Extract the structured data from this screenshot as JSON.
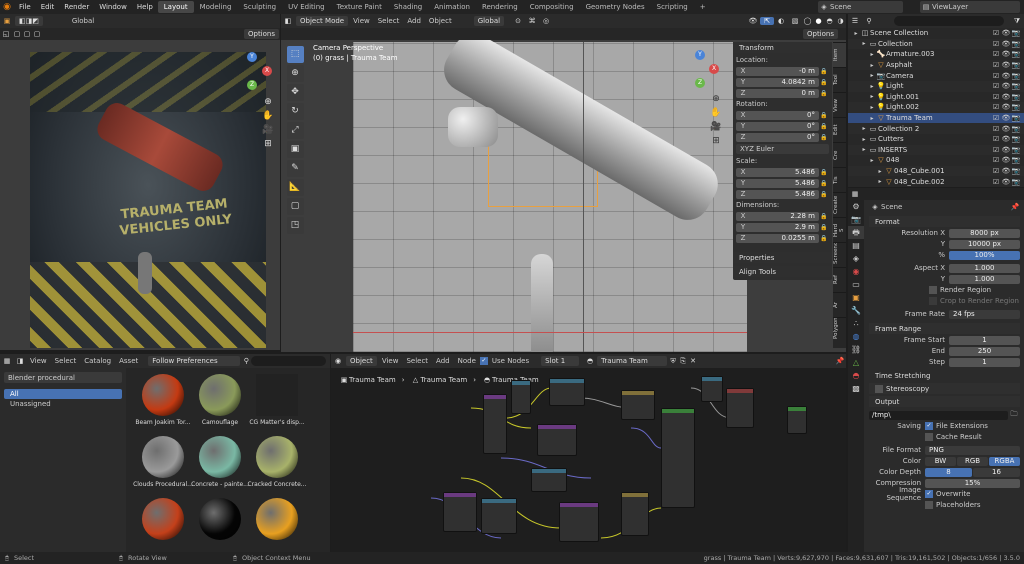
{
  "menu": {
    "items": [
      "File",
      "Edit",
      "Render",
      "Window",
      "Help"
    ]
  },
  "workspaces": {
    "items": [
      "Layout",
      "Modeling",
      "Sculpting",
      "UV Editing",
      "Texture Paint",
      "Shading",
      "Animation",
      "Rendering",
      "Compositing",
      "Geometry Nodes",
      "Scripting"
    ],
    "active": "Layout",
    "add": "+"
  },
  "scene": {
    "name": "Scene",
    "view_layer": "ViewLayer"
  },
  "left_viewport": {
    "orientation": "Global",
    "options": "Options",
    "title_lines": [
      "TRAUMA TEAM",
      "VEHICLES ONLY"
    ]
  },
  "viewport": {
    "mode": "Object Mode",
    "menus": [
      "View",
      "Select",
      "Add",
      "Object"
    ],
    "orientation": "Global",
    "options": "Options",
    "camera_label": "Camera Perspective",
    "object_label": "(0) grass | Trauma Team"
  },
  "transform": {
    "title": "Transform",
    "location_label": "Location:",
    "location": [
      {
        "k": "X",
        "v": "-0 m"
      },
      {
        "k": "Y",
        "v": "4.0842 m"
      },
      {
        "k": "Z",
        "v": "0 m"
      }
    ],
    "rotation_label": "Rotation:",
    "rotation": [
      {
        "k": "X",
        "v": "0°"
      },
      {
        "k": "Y",
        "v": "0°"
      },
      {
        "k": "Z",
        "v": "0°"
      }
    ],
    "euler": "XYZ Euler",
    "scale_label": "Scale:",
    "scale": [
      {
        "k": "X",
        "v": "5.486"
      },
      {
        "k": "Y",
        "v": "5.486"
      },
      {
        "k": "Z",
        "v": "5.486"
      }
    ],
    "dimensions_label": "Dimensions:",
    "dimensions": [
      {
        "k": "X",
        "v": "2.28 m"
      },
      {
        "k": "Y",
        "v": "2.9 m"
      },
      {
        "k": "Z",
        "v": "0.0255 m"
      }
    ],
    "properties": "Properties",
    "align_tools": "Align Tools"
  },
  "sidebar_tabs": [
    "Item",
    "Tool",
    "View",
    "Edit",
    "Cre",
    "Tis",
    "Create",
    "Hard S",
    "Screencast",
    "Ref",
    "Ar",
    "Polygon"
  ],
  "outliner": {
    "items": [
      {
        "name": "Scene Collection",
        "indent": 0
      },
      {
        "name": "Collection",
        "indent": 1
      },
      {
        "name": "Armature.003",
        "indent": 2
      },
      {
        "name": "Asphalt",
        "indent": 2
      },
      {
        "name": "Camera",
        "indent": 2
      },
      {
        "name": "Light",
        "indent": 2
      },
      {
        "name": "Light.001",
        "indent": 2
      },
      {
        "name": "Light.002",
        "indent": 2
      },
      {
        "name": "Trauma Team",
        "indent": 2
      },
      {
        "name": "Collection 2",
        "indent": 1
      },
      {
        "name": "Cutters",
        "indent": 1
      },
      {
        "name": "INSERTS",
        "indent": 1
      },
      {
        "name": "048",
        "indent": 2
      },
      {
        "name": "048_Cube.001",
        "indent": 3
      },
      {
        "name": "048_Cube.002",
        "indent": 3
      }
    ],
    "selected": "Trauma Team"
  },
  "properties": {
    "scene": "Scene",
    "format": "Format",
    "resolution_x_label": "Resolution X",
    "resolution_x": "8000 px",
    "resolution_y_label": "Y",
    "resolution_y": "10000 px",
    "percent_label": "%",
    "percent": "100%",
    "aspect_x_label": "Aspect X",
    "aspect_x": "1.000",
    "aspect_y_label": "Y",
    "aspect_y": "1.000",
    "render_region": "Render Region",
    "crop_region": "Crop to Render Region",
    "frame_rate_label": "Frame Rate",
    "frame_rate": "24 fps",
    "frame_range": "Frame Range",
    "frame_start_label": "Frame Start",
    "frame_start": "1",
    "end_label": "End",
    "end": "250",
    "step_label": "Step",
    "step": "1",
    "time_stretching": "Time Stretching",
    "stereoscopy": "Stereoscopy",
    "output": "Output",
    "path": "/tmp\\",
    "saving_label": "Saving",
    "file_extensions": "File Extensions",
    "cache_result": "Cache Result",
    "file_format_label": "File Format",
    "file_format": "PNG",
    "color_label": "Color",
    "color_opts": [
      "BW",
      "RGB",
      "RGBA"
    ],
    "color_active": "RGBA",
    "color_depth_label": "Color Depth",
    "depth_opts": [
      "8",
      "16"
    ],
    "compression_label": "Compression",
    "compression": "15%",
    "image_sequence_label": "Image Sequence",
    "overwrite": "Overwrite",
    "placeholders": "Placeholders"
  },
  "asset_browser": {
    "menus": [
      "View",
      "Select",
      "Catalog",
      "Asset"
    ],
    "prefs": "Follow Preferences",
    "library": "Blender procedural",
    "catalogs": [
      "All",
      "Unassigned"
    ],
    "assets": [
      {
        "name": "Beam Joakim Tor...",
        "color": "#c43a12"
      },
      {
        "name": "Camouflage",
        "color": "#8a9a5a"
      },
      {
        "name": "CG Matter's disp...",
        "color": "#222222"
      },
      {
        "name": "Clouds Procedural...",
        "color": "#9a9a9a"
      },
      {
        "name": "Concrete - painte...",
        "color": "#7ab8a4"
      },
      {
        "name": "Cracked Concrete...",
        "color": "#a8b26a"
      },
      {
        "name": "",
        "color": "#c4401a"
      },
      {
        "name": "",
        "color": "#050505"
      },
      {
        "name": "",
        "color": "#e8a020"
      }
    ]
  },
  "node_editor": {
    "type": "Object",
    "menus": [
      "View",
      "Select",
      "Add",
      "Node"
    ],
    "use_nodes": "Use Nodes",
    "slot": "Slot 1",
    "material": "Trauma Team",
    "breadcrumb": [
      "Trauma Team",
      "Trauma Team",
      "Trauma Team"
    ]
  },
  "status": {
    "select": "Select",
    "rotate": "Rotate View",
    "context": "Object Context Menu",
    "info": "grass | Trauma Team | Verts:9,627,970 | Faces:9,631,607 | Tris:19,161,502 | Objects:1/656 | 3.5.0"
  },
  "colors": {
    "accent": "#4772b3",
    "selected": "#334d80",
    "header": "#2b2b2b",
    "orange": "#e8a040"
  }
}
